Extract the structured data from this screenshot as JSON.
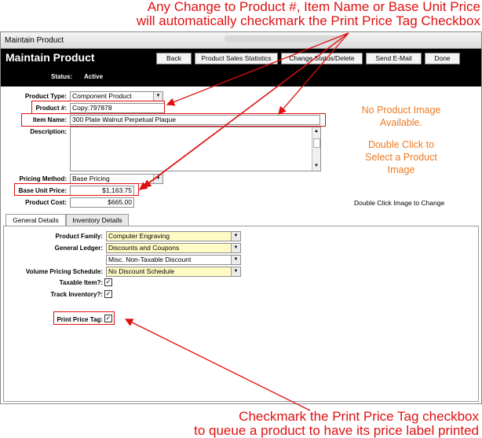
{
  "annotations": {
    "top_line1": "Any Change to Product #, Item Name or Base Unit Price",
    "top_line2": "will automatically checkmark the Print Price Tag Checkbox",
    "bottom_line1": "Checkmark the Print Price Tag checkbox",
    "bottom_line2": "to queue a product to have its price label printed"
  },
  "window": {
    "title": "Maintain Product"
  },
  "header": {
    "title": "Maintain Product",
    "status_label": "Status:",
    "status_value": "Active",
    "buttons": {
      "back": "Back",
      "stats": "Product Sales Statistics",
      "change_status": "Change Status/Delete",
      "email": "Send E-Mail",
      "done": "Done"
    }
  },
  "form": {
    "product_type_label": "Product Type:",
    "product_type_value": "Component Product",
    "product_num_label": "Product #:",
    "product_num_value": "Copy:797878",
    "item_name_label": "Item Name:",
    "item_name_value": "300 Plate Walnut Perpetual Plaque",
    "description_label": "Description:",
    "description_value": "",
    "pricing_method_label": "Pricing Method:",
    "pricing_method_value": "Base Pricing",
    "base_price_label": "Base Unit Price:",
    "base_price_value": "$1,163.75",
    "product_cost_label": "Product Cost:",
    "product_cost_value": "$665.00"
  },
  "image_panel": {
    "line1": "No Product Image",
    "line2": "Available.",
    "line3": "Double Click to",
    "line4": "Select a Product",
    "line5": "Image",
    "hint": "Double Click Image to Change"
  },
  "tabs": {
    "general": "General Details",
    "inventory": "Inventory Details"
  },
  "general": {
    "family_label": "Product Family:",
    "family_value": "Computer Engraving",
    "ledger_label": "General Ledger:",
    "ledger_value": "Discounts and Coupons",
    "ledger_value2": "Misc. Non-Taxable Discount",
    "volume_label": "Volume Pricing Schedule:",
    "volume_value": "No Discount Schedule",
    "taxable_label": "Taxable Item?:",
    "taxable_checked": "✓",
    "track_label": "Track Inventory?:",
    "track_checked": "✓",
    "print_label": "Print Price Tag:",
    "print_checked": "✓"
  },
  "colors": {
    "annotation_red": "#e01010",
    "image_text_orange": "#ee7a22",
    "header_black": "#000000",
    "field_yellow": "#fffbc4"
  }
}
